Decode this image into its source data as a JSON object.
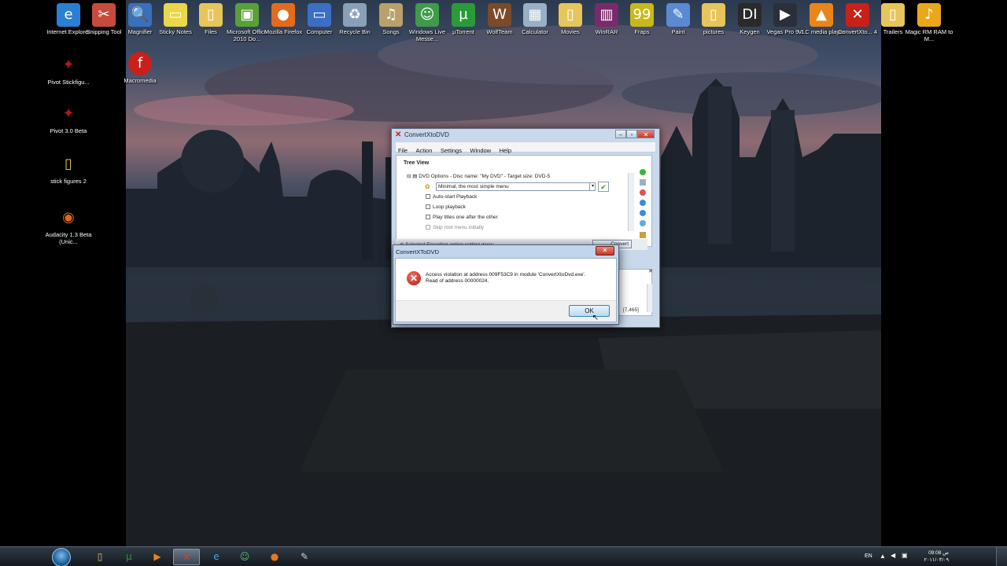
{
  "desktop": {
    "top_icons": [
      {
        "label": "Internet Explorer",
        "icon": "ie-icon",
        "glyph": "e",
        "color": "#2a7fd4"
      },
      {
        "label": "Snipping Tool",
        "icon": "snipping-tool-icon",
        "glyph": "✂",
        "color": "#c74b3b"
      },
      {
        "label": "Magnifier",
        "icon": "magnifier-icon",
        "glyph": "🔍",
        "color": "#3a6fbd"
      },
      {
        "label": "Sticky Notes",
        "icon": "sticky-notes-icon",
        "glyph": "▭",
        "color": "#e8d84a"
      },
      {
        "label": "Files",
        "icon": "folder-icon",
        "glyph": "▯",
        "color": "#e6c55a"
      },
      {
        "label": "Microsoft Office 2010 Do...",
        "icon": "office-icon",
        "glyph": "▣",
        "color": "#5aa03a"
      },
      {
        "label": "Mozilla Firefox",
        "icon": "firefox-icon",
        "glyph": "●",
        "color": "#e26c1c"
      },
      {
        "label": "Computer",
        "icon": "computer-icon",
        "glyph": "▭",
        "color": "#3a6fc4"
      },
      {
        "label": "Recycle Bin",
        "icon": "recycle-bin-icon",
        "glyph": "♻",
        "color": "#8aa0b8"
      },
      {
        "label": "Songs",
        "icon": "songs-icon",
        "glyph": "♫",
        "color": "#b8a16a"
      },
      {
        "label": "Windows Live Messe...",
        "icon": "messenger-icon",
        "glyph": "☺",
        "color": "#3f9a4a"
      },
      {
        "label": "µTorrent",
        "icon": "utorrent-icon",
        "glyph": "µ",
        "color": "#2b9a3a"
      },
      {
        "label": "WolfTeam",
        "icon": "wolfteam-icon",
        "glyph": "W",
        "color": "#7a4a2a"
      },
      {
        "label": "Calculator",
        "icon": "calculator-icon",
        "glyph": "▦",
        "color": "#9ab0c4"
      },
      {
        "label": "Movies",
        "icon": "movies-folder-icon",
        "glyph": "▯",
        "color": "#e6c55a"
      },
      {
        "label": "WinRAR",
        "icon": "winrar-icon",
        "glyph": "▥",
        "color": "#7a2a6a"
      },
      {
        "label": "Fraps",
        "icon": "fraps-icon",
        "glyph": "99",
        "color": "#c9b81a"
      },
      {
        "label": "Paint",
        "icon": "paint-icon",
        "glyph": "✎",
        "color": "#5a8ad4"
      },
      {
        "label": "pictures",
        "icon": "pictures-folder-icon",
        "glyph": "▯",
        "color": "#e6c55a"
      },
      {
        "label": "Keygen",
        "icon": "keygen-icon",
        "glyph": "DI",
        "color": "#2a2a2a"
      },
      {
        "label": "Vegas Pro 9.0",
        "icon": "vegas-icon",
        "glyph": "▶",
        "color": "#2a2f3a"
      },
      {
        "label": "VLC media player",
        "icon": "vlc-icon",
        "glyph": "▲",
        "color": "#e8861a"
      },
      {
        "label": "ConvertXto... 4",
        "icon": "convertxtodvd-icon",
        "glyph": "✕",
        "color": "#c8201a"
      },
      {
        "label": "Trailers",
        "icon": "trailers-folder-icon",
        "glyph": "▯",
        "color": "#e6c55a"
      },
      {
        "label": "Magic RM RAM to M...",
        "icon": "magic-rm-icon",
        "glyph": "♪",
        "color": "#e8a81a"
      }
    ],
    "left_icons": [
      {
        "label": "Pivot Stickfigu...",
        "icon": "pivot-shortcut-icon",
        "glyph": "✦",
        "color": "#b01818"
      },
      {
        "label": "Pivot 3.0 Beta",
        "icon": "pivot-beta-icon",
        "glyph": "✦",
        "color": "#b01818"
      },
      {
        "label": "stick figures 2",
        "icon": "stick-figures-folder-icon",
        "glyph": "▯",
        "color": "#e6c55a"
      },
      {
        "label": "Audacity 1.3 Beta (Unic...",
        "icon": "audacity-icon",
        "glyph": "◉",
        "color": "#e0661a"
      }
    ],
    "extra_icon": {
      "label": "Macromedia",
      "icon": "macromedia-flash-icon",
      "glyph": "f",
      "color": "#c8201a"
    }
  },
  "main_window": {
    "title": "ConvertXtoDVD",
    "menu": [
      "File",
      "Action",
      "Settings",
      "Window",
      "Help"
    ],
    "tree_view_label": "Tree View",
    "dvd_options": "DVD Options - Disc name: \"My DVD\" - Target size: DVD-5",
    "menu_template": "Minimal, the most simple menu",
    "options": [
      "Auto-start Playback",
      "Loop playback",
      "Play titles one after the other",
      "Skip root menu initially"
    ],
    "encoding_label": "Selected Encoding option setting gives:",
    "convert_label": "Convert",
    "log_value": "[7,465]"
  },
  "dialog": {
    "title": "ConvertXToDVD",
    "close_label": "✕",
    "message_line1": "Access violation at address 009F53C9 in module 'ConvertXtoDvd.exe'.",
    "message_line2": "Read of address 00000024.",
    "ok_label": "OK"
  },
  "taskbar": {
    "pinned": [
      {
        "name": "explorer-taskbar-icon",
        "glyph": "▯",
        "color": "#e6c55a"
      },
      {
        "name": "utorrent-taskbar-icon",
        "glyph": "µ",
        "color": "#2b9a3a"
      },
      {
        "name": "media-player-taskbar-icon",
        "glyph": "▶",
        "color": "#e8861a"
      },
      {
        "name": "convertxtodvd-taskbar-icon",
        "glyph": "✕",
        "color": "#e33a2a"
      },
      {
        "name": "ie-taskbar-icon",
        "glyph": "e",
        "color": "#4a9fe8"
      },
      {
        "name": "messenger-taskbar-icon",
        "glyph": "☺",
        "color": "#5ac06a"
      },
      {
        "name": "firefox-taskbar-icon",
        "glyph": "●",
        "color": "#e8761c"
      },
      {
        "name": "app-taskbar-icon",
        "glyph": "✎",
        "color": "#d0d0d0"
      }
    ],
    "language": "EN",
    "time": "09:08 ص",
    "date": "٢٠١١/٠٣/٠٩"
  }
}
